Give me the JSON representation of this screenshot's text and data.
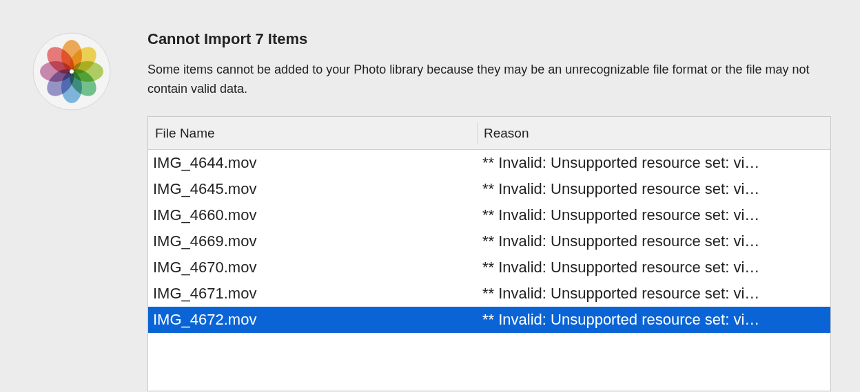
{
  "dialog": {
    "title": "Cannot Import 7 Items",
    "message": "Some items cannot be added to your Photo library because they may be an unrecognizable file format or the file may not contain valid data."
  },
  "table": {
    "columns": [
      "File Name",
      "Reason"
    ],
    "rows": [
      {
        "file_name": "IMG_4644.mov",
        "reason": "** Invalid: Unsupported resource set: vi…",
        "selected": false
      },
      {
        "file_name": "IMG_4645.mov",
        "reason": "** Invalid: Unsupported resource set: vi…",
        "selected": false
      },
      {
        "file_name": "IMG_4660.mov",
        "reason": "** Invalid: Unsupported resource set: vi…",
        "selected": false
      },
      {
        "file_name": "IMG_4669.mov",
        "reason": "** Invalid: Unsupported resource set: vi…",
        "selected": false
      },
      {
        "file_name": "IMG_4670.mov",
        "reason": "** Invalid: Unsupported resource set: vi…",
        "selected": false
      },
      {
        "file_name": "IMG_4671.mov",
        "reason": "** Invalid: Unsupported resource set: vi…",
        "selected": false
      },
      {
        "file_name": "IMG_4672.mov",
        "reason": "** Invalid: Unsupported resource set: vi…",
        "selected": true
      }
    ]
  }
}
